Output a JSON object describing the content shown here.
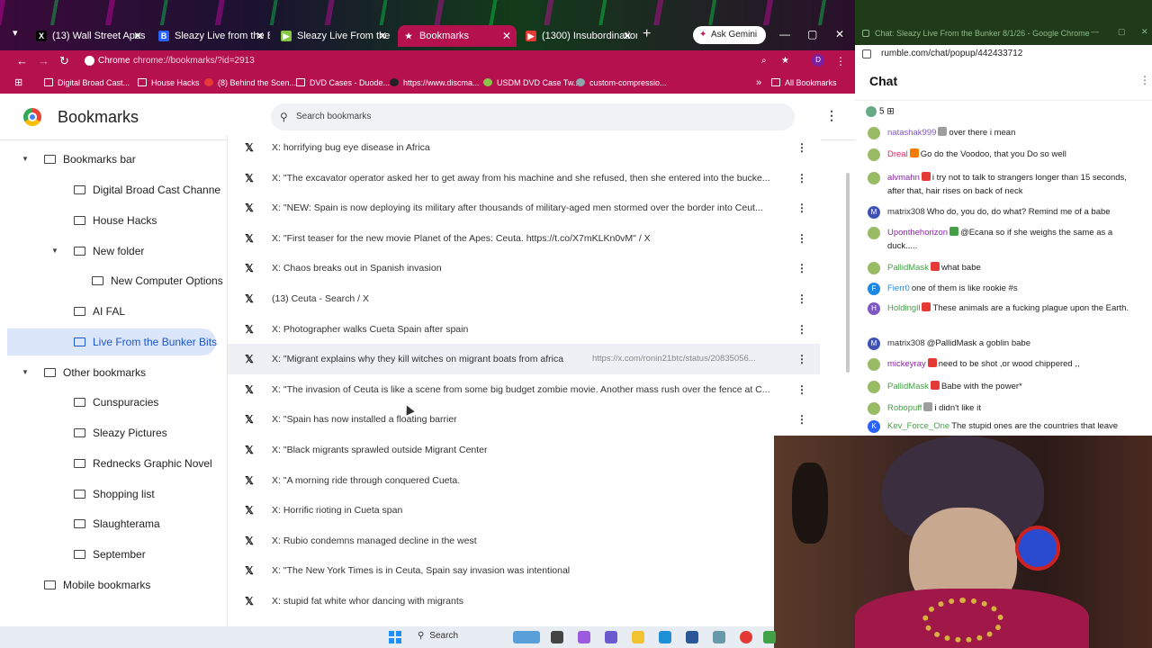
{
  "tabs": [
    {
      "label": "(13) Wall Street Apes on",
      "icon": "x-logo-icon"
    },
    {
      "label": "Sleazy Live from the Bun",
      "icon": "b-logo-icon"
    },
    {
      "label": "Sleazy Live From the Bun",
      "icon": "rumble-icon"
    },
    {
      "label": "Bookmarks",
      "icon": "star-icon",
      "active": true
    },
    {
      "label": "(1300) Insubordination",
      "icon": "youtube-icon"
    }
  ],
  "gemini_label": "Ask Gemini",
  "address": {
    "chip": "Chrome",
    "url": "chrome://bookmarks/?id=2913"
  },
  "bookmarks_bar": [
    "Digital Broad Cast...",
    "House Hacks",
    "(8) Behind the Scen...",
    "DVD Cases - Duode...",
    "https://www.discma...",
    "USDM DVD Case Tw...",
    "custom-compressio..."
  ],
  "all_bookmarks": "All Bookmarks",
  "page": {
    "title": "Bookmarks",
    "search_placeholder": "Search bookmarks"
  },
  "sidebar": [
    {
      "label": "Bookmarks bar",
      "level": 0,
      "expanded": true
    },
    {
      "label": "Digital Broad Cast Channe",
      "level": 1
    },
    {
      "label": "House Hacks",
      "level": 1
    },
    {
      "label": "New folder",
      "level": 1,
      "expanded": true
    },
    {
      "label": "New Computer Options",
      "level": 2
    },
    {
      "label": "AI FAL",
      "level": 1
    },
    {
      "label": "Live From the Bunker Bits",
      "level": 1,
      "selected": true
    },
    {
      "label": "Other bookmarks",
      "level": 0,
      "expanded": true
    },
    {
      "label": "Cunspuracies",
      "level": 1
    },
    {
      "label": "Sleazy Pictures",
      "level": 1
    },
    {
      "label": "Rednecks Graphic Novel",
      "level": 1
    },
    {
      "label": "Shopping list",
      "level": 1
    },
    {
      "label": "Slaughterama",
      "level": 1
    },
    {
      "label": "September",
      "level": 1
    },
    {
      "label": "Mobile bookmarks",
      "level": 0
    }
  ],
  "bookmarks": [
    {
      "title": "X: horrifying bug eye disease in Africa"
    },
    {
      "title": "X: \"The excavator operator asked her to get away from his machine and she refused, then she entered into the bucke..."
    },
    {
      "title": "X: \"NEW: Spain is now deploying its military after thousands of military-aged men stormed over the border into Ceut..."
    },
    {
      "title": "X: \"First teaser for the new movie Planet of the Apes: Ceuta. https://t.co/X7mKLKn0vM\" / X"
    },
    {
      "title": "X: Chaos breaks out in Spanish invasion"
    },
    {
      "title": "(13) Ceuta - Search / X"
    },
    {
      "title": "X: Photographer walks Cueta Spain after spain"
    },
    {
      "title": "X: \"Migrant explains why they kill witches on migrant boats from africa",
      "url": "https://x.com/ronin21btc/status/20835056...",
      "hover": true
    },
    {
      "title": "X: \"The invasion of Ceuta is like a scene from some big budget zombie movie. Another mass rush over the fence at C..."
    },
    {
      "title": "X: \"Spain has now installed a floating barrier"
    },
    {
      "title": "X: \"Black migrants sprawled outside Migrant Center"
    },
    {
      "title": "X: \"A morning ride through conquered Cueta."
    },
    {
      "title": "X: Horrific rioting in Cueta span"
    },
    {
      "title": "X: Rubio condemns managed decline in the west"
    },
    {
      "title": "X: \"The New York Times is in Ceuta, Spain say invasion was intentional"
    },
    {
      "title": "X: stupid fat white whor dancing with migrants"
    }
  ],
  "chat_window": {
    "title": "Chat: Sleazy Live From the Bunker 8/1/26 - Google Chrome",
    "url": "rumble.com/chat/popup/442433712",
    "heading": "Chat",
    "viewers": "5"
  },
  "chat": [
    {
      "user": "natashak999",
      "color": "#7e57c2",
      "text": "over there i mean",
      "badge": "#9e9e9e"
    },
    {
      "user": "Dreal",
      "color": "#e91e63",
      "text": "Go do the Voodoo, that you Do so well",
      "badge": "#f57c00"
    },
    {
      "user": "alvmahn",
      "color": "#8e24aa",
      "text": "i try not to talk to strangers longer than 15 seconds, after that, hair rises on back of neck",
      "badge": "#e53935"
    },
    {
      "user": "matrix308",
      "color": "#333333",
      "text": "Who do, you do, do what? Remind me of a babe",
      "initial": "M"
    },
    {
      "user": "Uponthehorizon",
      "color": "#8e24aa",
      "text": "@Ecana so if she weighs the same as a duck.....",
      "badge": "#43a047"
    },
    {
      "user": "PallidMask",
      "color": "#43a047",
      "text": "what babe",
      "badge": "#e53935"
    },
    {
      "user": "Fierr0",
      "color": "#1e88e5",
      "text": "one of them is like rookie #s",
      "initial": "F"
    },
    {
      "user": "Holdingll",
      "color": "#43a047",
      "text": "These animals are a fucking plague upon the Earth.",
      "badge": "#e53935",
      "initial": "H"
    },
    {
      "user": "matrix308",
      "color": "#333333",
      "text": "@PallidMask a goblin babe",
      "initial": "M"
    },
    {
      "user": "mickeyray",
      "color": "#8e24aa",
      "text": "need to be shot ,or wood chippered ,,",
      "badge": "#e53935"
    },
    {
      "user": "PallidMask",
      "color": "#43a047",
      "text": "Babe with the power*",
      "badge": "#e53935"
    },
    {
      "user": "Robopuff",
      "color": "#43a047",
      "text": "i didn't like it",
      "badge": "#9e9e9e"
    },
    {
      "user": "Kev_Force_One",
      "color": "#43a047",
      "text": "The stupid ones are the countries that leave",
      "initial": "K"
    }
  ],
  "taskbar": {
    "search": "Search"
  },
  "colors": {
    "accent": "#b5114e",
    "selected": "#dbe6fb",
    "selected_text": "#1a55c8"
  }
}
